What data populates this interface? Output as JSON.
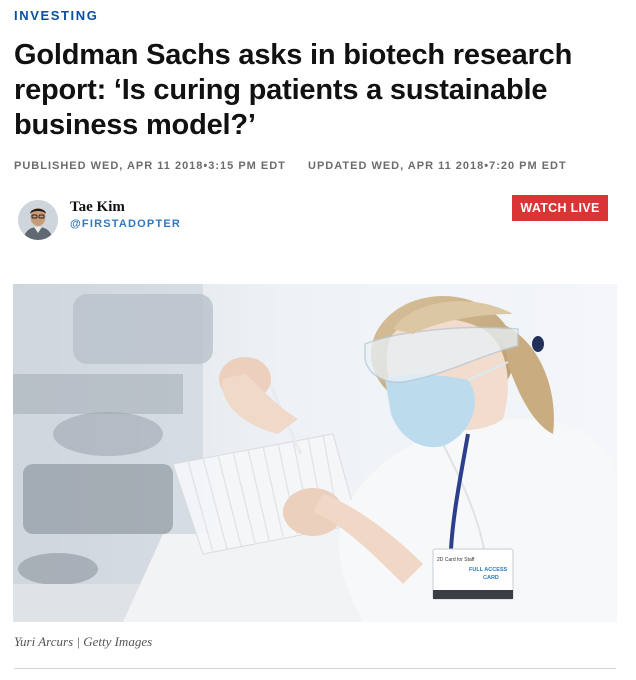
{
  "section": {
    "label": "INVESTING"
  },
  "article": {
    "headline": "Goldman Sachs asks in biotech research report: ‘Is curing patients a sustainable business model?’",
    "published": "PUBLISHED WED, APR 11 2018•3:15 PM EDT",
    "updated": "UPDATED WED, APR 11 2018•7:20 PM EDT"
  },
  "author": {
    "name": "Tae Kim",
    "handle": "@FIRSTADOPTER"
  },
  "header": {
    "watch_live_label": "WATCH LIVE"
  },
  "photo": {
    "badge_line1": "2D Card for Staff",
    "badge_line2": "FULL ACCESS",
    "badge_line3": "CARD",
    "caption": "Yuri Arcurs | Getty Images"
  },
  "colors": {
    "section_blue": "#0a4fa3",
    "handle_blue": "#2f78c4",
    "watch_live_red": "#d93535",
    "meta_gray": "#6c6c6c"
  }
}
